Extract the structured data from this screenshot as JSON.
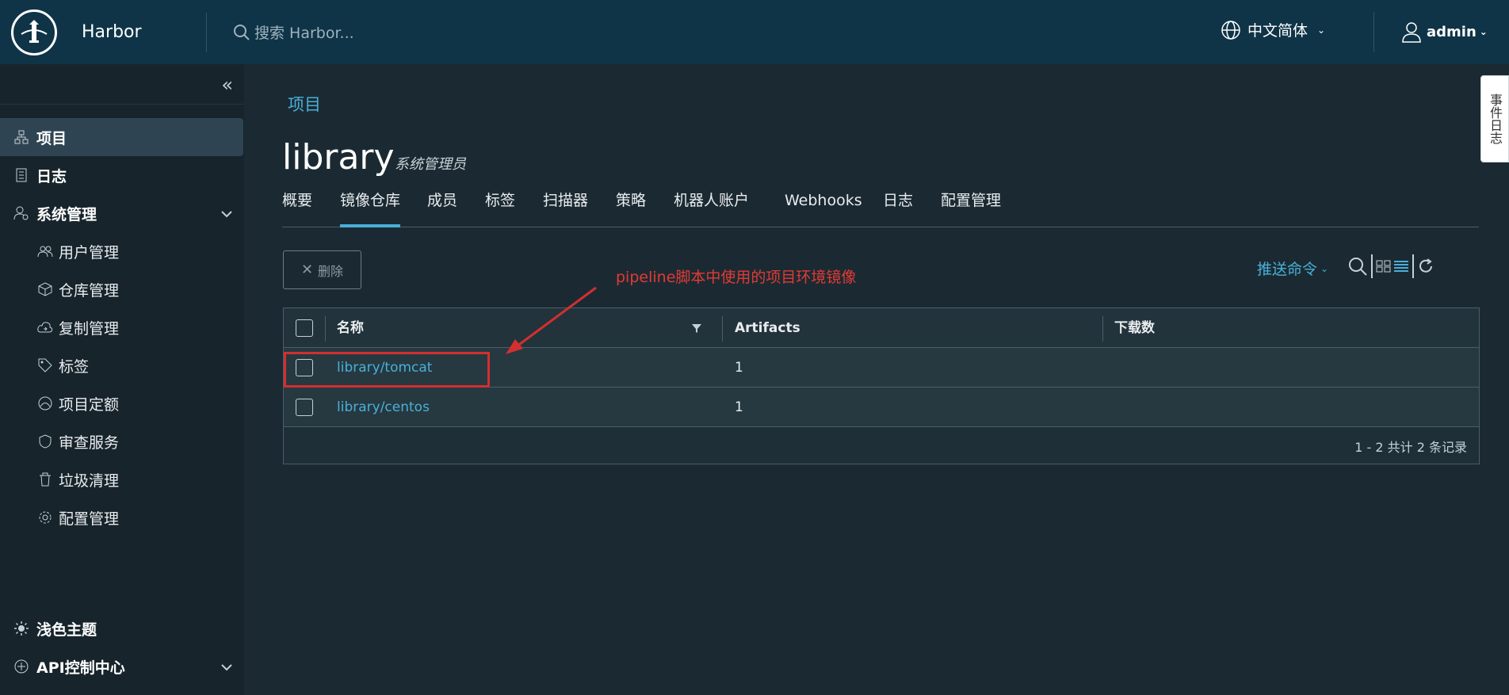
{
  "header": {
    "brand": "Harbor",
    "search_placeholder": "搜索 Harbor...",
    "language": "中文简体",
    "user": "admin"
  },
  "sidebar": {
    "items": [
      {
        "label": "项目",
        "icon": "projects-icon",
        "active": true
      },
      {
        "label": "日志",
        "icon": "logs-icon"
      },
      {
        "label": "系统管理",
        "icon": "admin-icon"
      }
    ],
    "sub_items": [
      {
        "label": "用户管理",
        "icon": "users-icon"
      },
      {
        "label": "仓库管理",
        "icon": "registry-icon"
      },
      {
        "label": "复制管理",
        "icon": "replication-icon"
      },
      {
        "label": "标签",
        "icon": "tag-icon"
      },
      {
        "label": "项目定额",
        "icon": "quota-icon"
      },
      {
        "label": "审查服务",
        "icon": "shield-icon"
      },
      {
        "label": "垃圾清理",
        "icon": "trash-icon"
      },
      {
        "label": "配置管理",
        "icon": "gear-icon"
      }
    ],
    "bottom": [
      {
        "label": "浅色主题",
        "icon": "sun-icon"
      },
      {
        "label": "API控制中心",
        "icon": "api-icon"
      }
    ]
  },
  "main": {
    "breadcrumb": "项目",
    "title": "library",
    "role": "系统管理员",
    "tabs": [
      "概要",
      "镜像仓库",
      "成员",
      "标签",
      "扫描器",
      "策略",
      "机器人账户",
      "Webhooks",
      "日志",
      "配置管理"
    ],
    "active_tab": "镜像仓库",
    "delete_label": "删除",
    "push_command": "推送命令",
    "annotation": "pipeline脚本中使用的项目环境镜像",
    "table": {
      "columns": [
        "名称",
        "Artifacts",
        "下载数"
      ],
      "rows": [
        {
          "name": "library/tomcat",
          "artifacts": "1",
          "downloads": ""
        },
        {
          "name": "library/centos",
          "artifacts": "1",
          "downloads": ""
        }
      ],
      "footer": "1 - 2 共计 2 条记录"
    }
  },
  "event_log": "事件日志",
  "colors": {
    "header_bg": "#0f3447",
    "sidebar_bg": "#17242b",
    "accent": "#49afd9",
    "annotation": "#e53935"
  }
}
